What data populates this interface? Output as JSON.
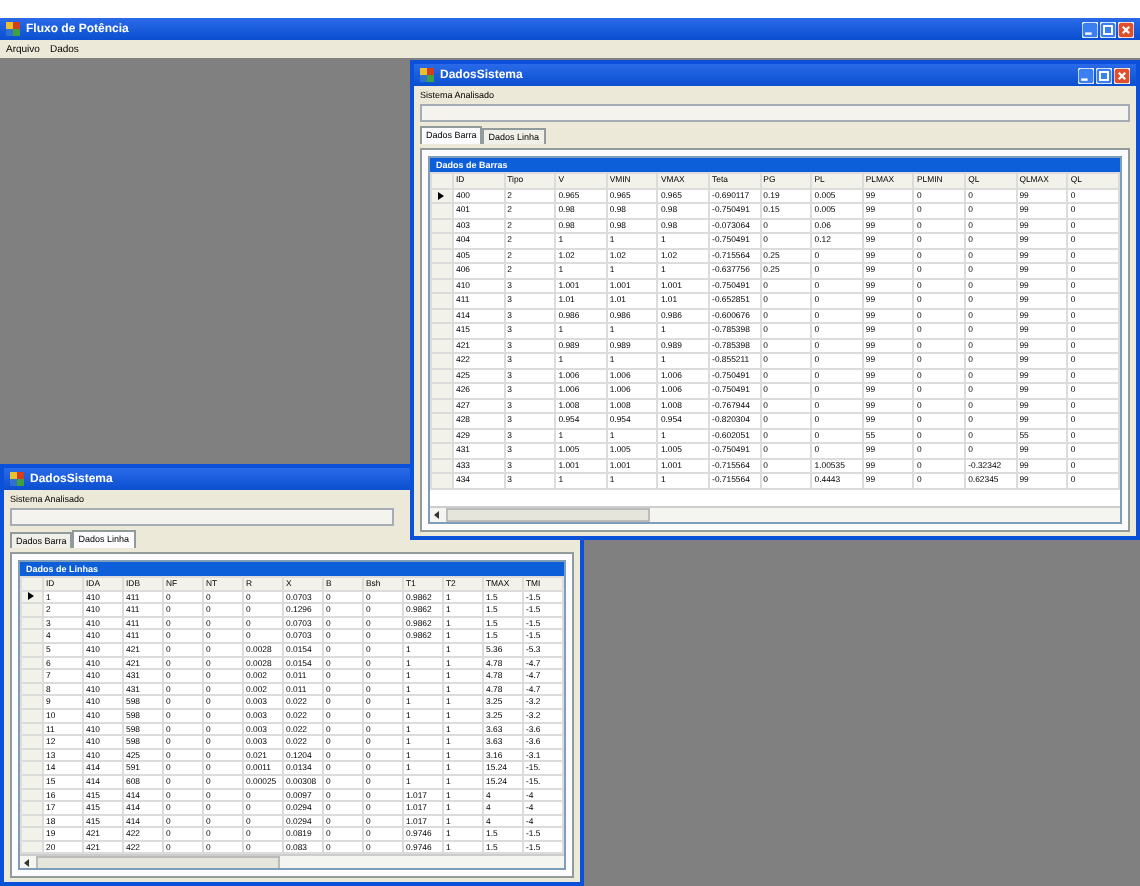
{
  "app": {
    "title": "Fluxo de Potência",
    "menu": [
      "Arquivo",
      "Dados"
    ]
  },
  "windows": [
    {
      "title": "DadosSistema",
      "label": "Sistema Analisado",
      "tabs": [
        {
          "label": "Dados Barra",
          "selected": true
        },
        {
          "label": "Dados Linha",
          "selected": false
        }
      ],
      "grid": {
        "caption": "Dados de Barras",
        "columns": [
          "ID",
          "Tipo",
          "V",
          "VMIN",
          "VMAX",
          "Teta",
          "PG",
          "PL",
          "PLMAX",
          "PLMIN",
          "QL",
          "QLMAX",
          "QL"
        ],
        "rows": [
          {
            "selected": true,
            "cells": [
              "400",
              "2",
              "0.965",
              "0.965",
              "0.965",
              "-0.690117",
              "0.19",
              "0.005",
              "99",
              "0",
              "0",
              "99",
              "0"
            ]
          },
          {
            "selected": false,
            "cells": [
              "401",
              "2",
              "0.98",
              "0.98",
              "0.98",
              "-0.750491",
              "0.15",
              "0.005",
              "99",
              "0",
              "0",
              "99",
              "0"
            ]
          },
          {
            "selected": false,
            "cells": [
              "403",
              "2",
              "0.98",
              "0.98",
              "0.98",
              "-0.073064",
              "0",
              "0.06",
              "99",
              "0",
              "0",
              "99",
              "0"
            ]
          },
          {
            "selected": false,
            "cells": [
              "404",
              "2",
              "1",
              "1",
              "1",
              "-0.750491",
              "0",
              "0.12",
              "99",
              "0",
              "0",
              "99",
              "0"
            ]
          },
          {
            "selected": false,
            "cells": [
              "405",
              "2",
              "1.02",
              "1.02",
              "1.02",
              "-0.715564",
              "0.25",
              "0",
              "99",
              "0",
              "0",
              "99",
              "0"
            ]
          },
          {
            "selected": false,
            "cells": [
              "406",
              "2",
              "1",
              "1",
              "1",
              "-0.637756",
              "0.25",
              "0",
              "99",
              "0",
              "0",
              "99",
              "0"
            ]
          },
          {
            "selected": false,
            "cells": [
              "410",
              "3",
              "1.001",
              "1.001",
              "1.001",
              "-0.750491",
              "0",
              "0",
              "99",
              "0",
              "0",
              "99",
              "0"
            ]
          },
          {
            "selected": false,
            "cells": [
              "411",
              "3",
              "1.01",
              "1.01",
              "1.01",
              "-0.652851",
              "0",
              "0",
              "99",
              "0",
              "0",
              "99",
              "0"
            ]
          },
          {
            "selected": false,
            "cells": [
              "414",
              "3",
              "0.986",
              "0.986",
              "0.986",
              "-0.600676",
              "0",
              "0",
              "99",
              "0",
              "0",
              "99",
              "0"
            ]
          },
          {
            "selected": false,
            "cells": [
              "415",
              "3",
              "1",
              "1",
              "1",
              "-0.785398",
              "0",
              "0",
              "99",
              "0",
              "0",
              "99",
              "0"
            ]
          },
          {
            "selected": false,
            "cells": [
              "421",
              "3",
              "0.989",
              "0.989",
              "0.989",
              "-0.785398",
              "0",
              "0",
              "99",
              "0",
              "0",
              "99",
              "0"
            ]
          },
          {
            "selected": false,
            "cells": [
              "422",
              "3",
              "1",
              "1",
              "1",
              "-0.855211",
              "0",
              "0",
              "99",
              "0",
              "0",
              "99",
              "0"
            ]
          },
          {
            "selected": false,
            "cells": [
              "425",
              "3",
              "1.006",
              "1.006",
              "1.006",
              "-0.750491",
              "0",
              "0",
              "99",
              "0",
              "0",
              "99",
              "0"
            ]
          },
          {
            "selected": false,
            "cells": [
              "426",
              "3",
              "1.006",
              "1.006",
              "1.006",
              "-0.750491",
              "0",
              "0",
              "99",
              "0",
              "0",
              "99",
              "0"
            ]
          },
          {
            "selected": false,
            "cells": [
              "427",
              "3",
              "1.008",
              "1.008",
              "1.008",
              "-0.767944",
              "0",
              "0",
              "99",
              "0",
              "0",
              "99",
              "0"
            ]
          },
          {
            "selected": false,
            "cells": [
              "428",
              "3",
              "0.954",
              "0.954",
              "0.954",
              "-0.820304",
              "0",
              "0",
              "99",
              "0",
              "0",
              "99",
              "0"
            ]
          },
          {
            "selected": false,
            "cells": [
              "429",
              "3",
              "1",
              "1",
              "1",
              "-0.602051",
              "0",
              "0",
              "55",
              "0",
              "0",
              "55",
              "0"
            ]
          },
          {
            "selected": false,
            "cells": [
              "431",
              "3",
              "1.005",
              "1.005",
              "1.005",
              "-0.750491",
              "0",
              "0",
              "99",
              "0",
              "0",
              "99",
              "0"
            ]
          },
          {
            "selected": false,
            "cells": [
              "433",
              "3",
              "1.001",
              "1.001",
              "1.001",
              "-0.715564",
              "0",
              "1.00535",
              "99",
              "0",
              "-0.32342",
              "99",
              "0"
            ]
          },
          {
            "selected": false,
            "cells": [
              "434",
              "3",
              "1",
              "1",
              "1",
              "-0.715564",
              "0",
              "0.4443",
              "99",
              "0",
              "0.62345",
              "99",
              "0"
            ]
          }
        ]
      }
    },
    {
      "title": "DadosSistema",
      "label": "Sistema Analisado",
      "tabs": [
        {
          "label": "Dados Barra",
          "selected": false
        },
        {
          "label": "Dados Linha",
          "selected": true
        }
      ],
      "grid": {
        "caption": "Dados de Linhas",
        "columns": [
          "ID",
          "IDA",
          "IDB",
          "NF",
          "NT",
          "R",
          "X",
          "B",
          "Bsh",
          "T1",
          "T2",
          "TMAX",
          "TMI"
        ],
        "rows": [
          {
            "selected": true,
            "cells": [
              "1",
              "410",
              "411",
              "0",
              "0",
              "0",
              "0.0703",
              "0",
              "0",
              "0.9862",
              "1",
              "1.5",
              "-1.5"
            ]
          },
          {
            "selected": false,
            "cells": [
              "2",
              "410",
              "411",
              "0",
              "0",
              "0",
              "0.1296",
              "0",
              "0",
              "0.9862",
              "1",
              "1.5",
              "-1.5"
            ]
          },
          {
            "selected": false,
            "cells": [
              "3",
              "410",
              "411",
              "0",
              "0",
              "0",
              "0.0703",
              "0",
              "0",
              "0.9862",
              "1",
              "1.5",
              "-1.5"
            ]
          },
          {
            "selected": false,
            "cells": [
              "4",
              "410",
              "411",
              "0",
              "0",
              "0",
              "0.0703",
              "0",
              "0",
              "0.9862",
              "1",
              "1.5",
              "-1.5"
            ]
          },
          {
            "selected": false,
            "cells": [
              "5",
              "410",
              "421",
              "0",
              "0",
              "0.0028",
              "0.0154",
              "0",
              "0",
              "1",
              "1",
              "5.36",
              "-5.3"
            ]
          },
          {
            "selected": false,
            "cells": [
              "6",
              "410",
              "421",
              "0",
              "0",
              "0.0028",
              "0.0154",
              "0",
              "0",
              "1",
              "1",
              "4.78",
              "-4.7"
            ]
          },
          {
            "selected": false,
            "cells": [
              "7",
              "410",
              "431",
              "0",
              "0",
              "0.002",
              "0.011",
              "0",
              "0",
              "1",
              "1",
              "4.78",
              "-4.7"
            ]
          },
          {
            "selected": false,
            "cells": [
              "8",
              "410",
              "431",
              "0",
              "0",
              "0.002",
              "0.011",
              "0",
              "0",
              "1",
              "1",
              "4.78",
              "-4.7"
            ]
          },
          {
            "selected": false,
            "cells": [
              "9",
              "410",
              "598",
              "0",
              "0",
              "0.003",
              "0.022",
              "0",
              "0",
              "1",
              "1",
              "3.25",
              "-3.2"
            ]
          },
          {
            "selected": false,
            "cells": [
              "10",
              "410",
              "598",
              "0",
              "0",
              "0.003",
              "0.022",
              "0",
              "0",
              "1",
              "1",
              "3.25",
              "-3.2"
            ]
          },
          {
            "selected": false,
            "cells": [
              "11",
              "410",
              "598",
              "0",
              "0",
              "0.003",
              "0.022",
              "0",
              "0",
              "1",
              "1",
              "3.63",
              "-3.6"
            ]
          },
          {
            "selected": false,
            "cells": [
              "12",
              "410",
              "598",
              "0",
              "0",
              "0.003",
              "0.022",
              "0",
              "0",
              "1",
              "1",
              "3.63",
              "-3.6"
            ]
          },
          {
            "selected": false,
            "cells": [
              "13",
              "410",
              "425",
              "0",
              "0",
              "0.021",
              "0.1204",
              "0",
              "0",
              "1",
              "1",
              "3.16",
              "-3.1"
            ]
          },
          {
            "selected": false,
            "cells": [
              "14",
              "414",
              "591",
              "0",
              "0",
              "0.0011",
              "0.0134",
              "0",
              "0",
              "1",
              "1",
              "15.24",
              "-15."
            ]
          },
          {
            "selected": false,
            "cells": [
              "15",
              "414",
              "608",
              "0",
              "0",
              "0.00025",
              "0.00308",
              "0",
              "0",
              "1",
              "1",
              "15.24",
              "-15."
            ]
          },
          {
            "selected": false,
            "cells": [
              "16",
              "415",
              "414",
              "0",
              "0",
              "0",
              "0.0097",
              "0",
              "0",
              "1.017",
              "1",
              "4",
              "-4"
            ]
          },
          {
            "selected": false,
            "cells": [
              "17",
              "415",
              "414",
              "0",
              "0",
              "0",
              "0.0294",
              "0",
              "0",
              "1.017",
              "1",
              "4",
              "-4"
            ]
          },
          {
            "selected": false,
            "cells": [
              "18",
              "415",
              "414",
              "0",
              "0",
              "0",
              "0.0294",
              "0",
              "0",
              "1.017",
              "1",
              "4",
              "-4"
            ]
          },
          {
            "selected": false,
            "cells": [
              "19",
              "421",
              "422",
              "0",
              "0",
              "0",
              "0.0819",
              "0",
              "0",
              "0.9746",
              "1",
              "1.5",
              "-1.5"
            ]
          },
          {
            "selected": false,
            "cells": [
              "20",
              "421",
              "422",
              "0",
              "0",
              "0",
              "0.083",
              "0",
              "0",
              "0.9746",
              "1",
              "1.5",
              "-1.5"
            ]
          }
        ]
      }
    }
  ]
}
